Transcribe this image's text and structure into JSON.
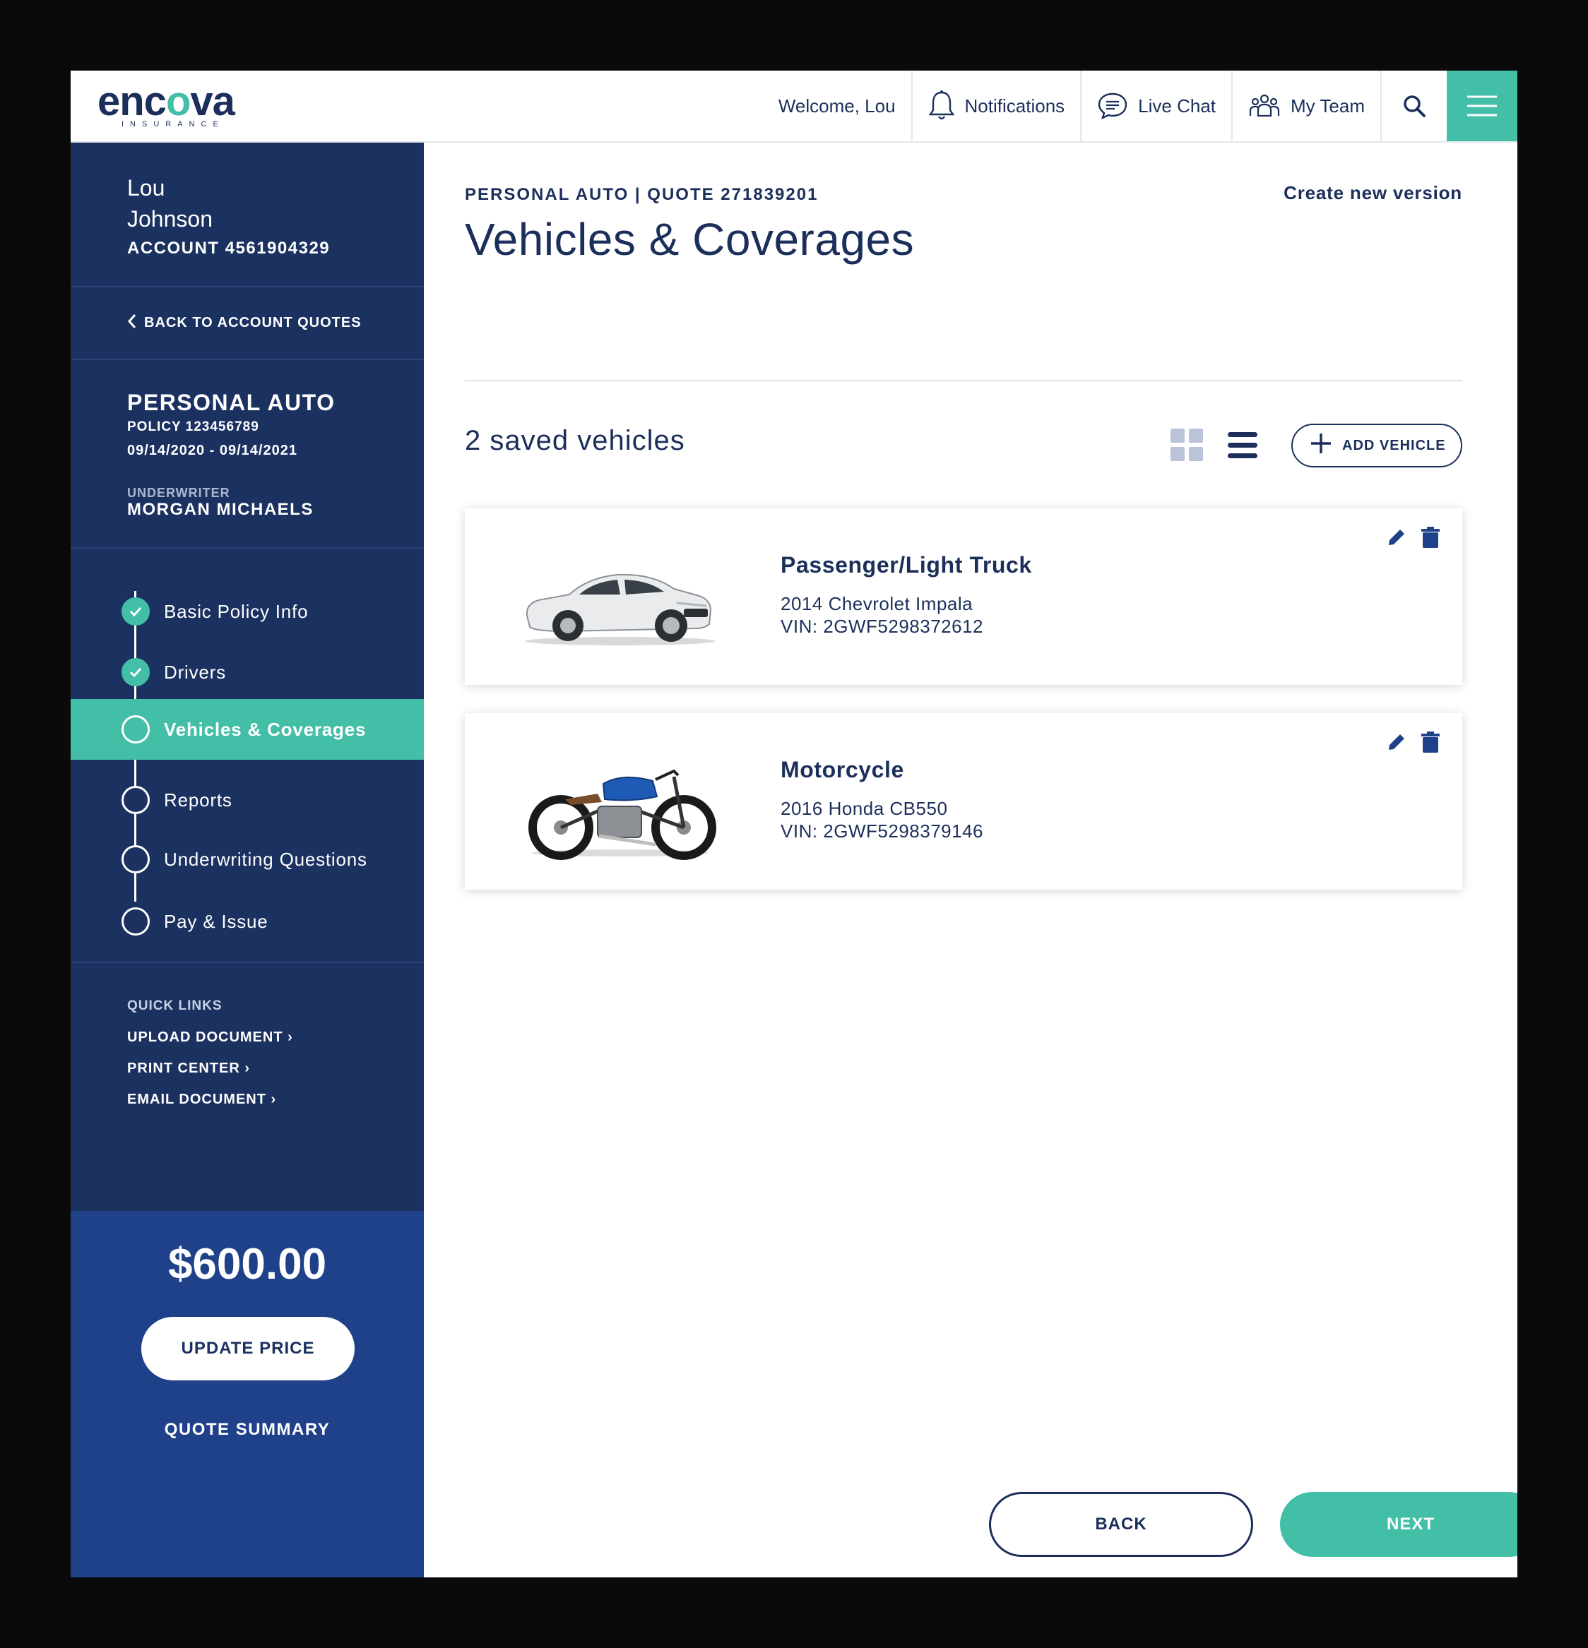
{
  "brand": {
    "name_part1": "enc",
    "name_part2": "o",
    "name_part3": "va",
    "tagline": "INSURANCE"
  },
  "header": {
    "welcome": "Welcome, Lou",
    "notifications": "Notifications",
    "live_chat": "Live Chat",
    "my_team": "My Team",
    "icons": [
      "bell-icon",
      "chat-icon",
      "team-icon",
      "search-icon",
      "hamburger-menu-icon"
    ]
  },
  "sidebar": {
    "first_name": "Lou",
    "last_name": "Johnson",
    "account": "ACCOUNT 4561904329",
    "back_link": "BACK TO ACCOUNT QUOTES",
    "policy_title": "PERSONAL AUTO",
    "policy_number": "POLICY 123456789",
    "policy_dates": "09/14/2020 - 09/14/2021",
    "underwriter_label": "UNDERWRITER",
    "underwriter_name": "MORGAN MICHAELS",
    "steps": [
      {
        "label": "Basic Policy Info",
        "status": "done"
      },
      {
        "label": "Drivers",
        "status": "done"
      },
      {
        "label": "Vehicles & Coverages",
        "status": "active"
      },
      {
        "label": "Reports",
        "status": "pending"
      },
      {
        "label": "Underwriting Questions",
        "status": "pending"
      },
      {
        "label": "Pay & Issue",
        "status": "pending"
      }
    ],
    "quick_links_title": "QUICK LINKS",
    "quick_links": [
      "UPLOAD DOCUMENT ›",
      "PRINT CENTER ›",
      "EMAIL DOCUMENT ›"
    ],
    "price": "$600.00",
    "update_price": "UPDATE PRICE",
    "quote_summary": "QUOTE SUMMARY"
  },
  "main": {
    "breadcrumb": "PERSONAL AUTO | QUOTE 271839201",
    "create_version": "Create new version",
    "title": "Vehicles & Coverages",
    "saved_count": "2 saved vehicles",
    "add_vehicle": "ADD VEHICLE",
    "vehicles": [
      {
        "type": "Passenger/Light Truck",
        "description": "2014 Chevrolet Impala",
        "vin": "VIN: 2GWF5298372612",
        "image": "car"
      },
      {
        "type": "Motorcycle",
        "description": "2016 Honda CB550",
        "vin": "VIN: 2GWF5298379146",
        "image": "motorcycle"
      }
    ],
    "back": "BACK",
    "next": "NEXT"
  },
  "colors": {
    "navy": "#1b3160",
    "teal": "#43bfa7",
    "price_blue": "#1f4189",
    "text": "#1c2f5b"
  }
}
